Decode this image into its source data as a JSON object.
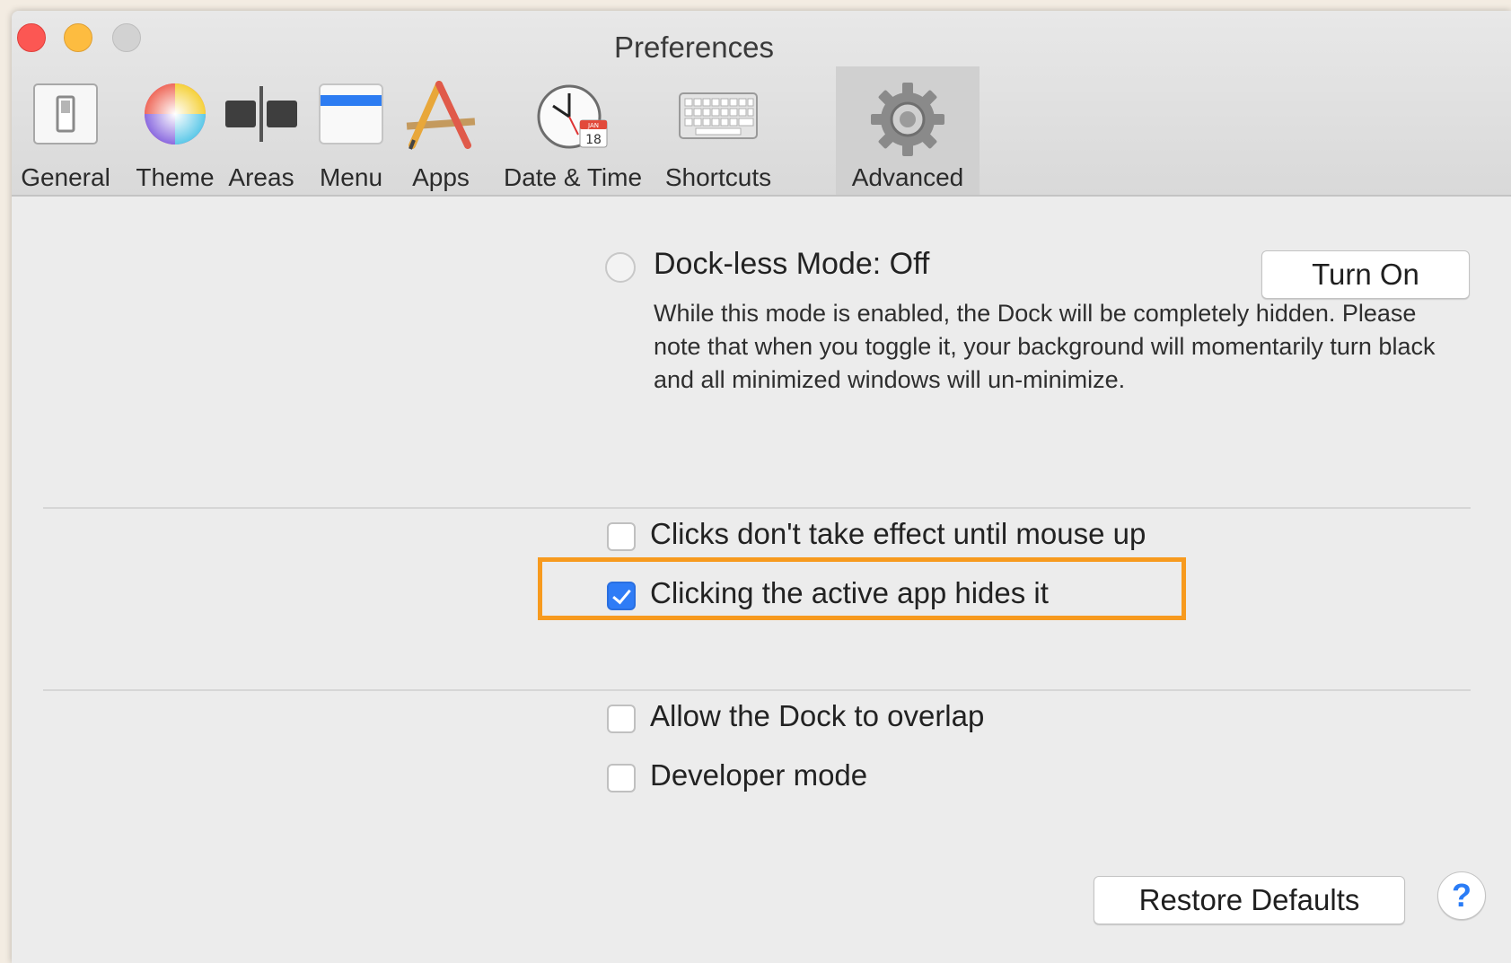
{
  "window": {
    "title": "Preferences"
  },
  "tabs": [
    {
      "label": "General",
      "icon": "switch-icon"
    },
    {
      "label": "Theme",
      "icon": "color-wheel-icon"
    },
    {
      "label": "Areas",
      "icon": "areas-icon"
    },
    {
      "label": "Menu",
      "icon": "menu-bar-icon"
    },
    {
      "label": "Apps",
      "icon": "app-store-icon"
    },
    {
      "label": "Date & Time",
      "icon": "clock-calendar-icon"
    },
    {
      "label": "Shortcuts",
      "icon": "keyboard-icon"
    },
    {
      "label": "Advanced",
      "icon": "gear-icon",
      "active": true
    }
  ],
  "dockless": {
    "label": "Dock-less Mode: Off",
    "button": "Turn On",
    "description": "While this mode is enabled, the Dock will be completely hidden. Please note that when you toggle it, your background will momentarily turn black and all minimized windows will un-minimize."
  },
  "options": [
    {
      "label": "Clicks don't take effect until mouse up",
      "checked": false
    },
    {
      "label": "Clicking the active app hides it",
      "checked": true
    },
    {
      "label": "Allow the Dock to overlap",
      "checked": false
    },
    {
      "label": "Developer mode",
      "checked": false
    }
  ],
  "footer": {
    "restore_label": "Restore Defaults",
    "help_label": "?"
  },
  "colors": {
    "accent": "#2f7cf6",
    "highlight": "#f79a1e"
  },
  "calendar_badge": {
    "month": "JAN",
    "day": "18"
  }
}
